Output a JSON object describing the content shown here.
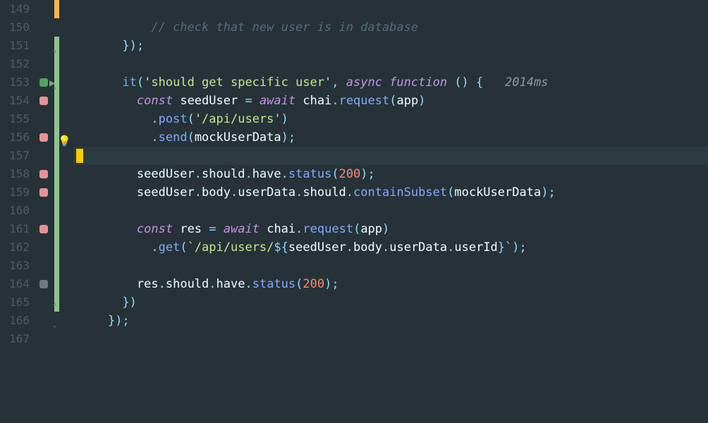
{
  "lines": [
    {
      "num": "149",
      "marker": "",
      "code": "",
      "indent": ""
    },
    {
      "num": "150",
      "marker": "",
      "code": "comment",
      "indent": "          "
    },
    {
      "num": "151",
      "marker": "",
      "code": "close1",
      "indent": "      "
    },
    {
      "num": "152",
      "marker": "",
      "code": "",
      "indent": ""
    },
    {
      "num": "153",
      "marker": "green-run",
      "code": "it",
      "indent": "      "
    },
    {
      "num": "154",
      "marker": "pink",
      "code": "const1",
      "indent": "        "
    },
    {
      "num": "155",
      "marker": "",
      "code": "post",
      "indent": "          "
    },
    {
      "num": "156",
      "marker": "pink",
      "code": "send",
      "indent": "          "
    },
    {
      "num": "157",
      "marker": "",
      "code": "",
      "indent": "",
      "highlighted": true
    },
    {
      "num": "158",
      "marker": "pink",
      "code": "status1",
      "indent": "        "
    },
    {
      "num": "159",
      "marker": "pink",
      "code": "subset",
      "indent": "        "
    },
    {
      "num": "160",
      "marker": "",
      "code": "",
      "indent": ""
    },
    {
      "num": "161",
      "marker": "pink",
      "code": "const2",
      "indent": "        "
    },
    {
      "num": "162",
      "marker": "",
      "code": "get",
      "indent": "          "
    },
    {
      "num": "163",
      "marker": "",
      "code": "",
      "indent": ""
    },
    {
      "num": "164",
      "marker": "gray",
      "code": "status2",
      "indent": "        "
    },
    {
      "num": "165",
      "marker": "",
      "code": "close2",
      "indent": "      "
    },
    {
      "num": "166",
      "marker": "",
      "code": "close3",
      "indent": "    "
    },
    {
      "num": "167",
      "marker": "",
      "code": "",
      "indent": ""
    }
  ],
  "text": {
    "comment": "// check that new user is in database",
    "close_brace_paren_semi": "});",
    "close_brace_paren": "})",
    "it_fn": "it",
    "it_string": "'should get specific user'",
    "async": "async",
    "function": "function",
    "timing": "2014ms",
    "const": "const",
    "await": "await",
    "seedUser": "seedUser",
    "chai": "chai",
    "request": "request",
    "app": "app",
    "post": "post",
    "post_path": "'/api/users'",
    "send": "send",
    "mockUserData": "mockUserData",
    "should": "should",
    "have": "have",
    "status": "status",
    "status_200": "200",
    "body": "body",
    "userData": "userData",
    "containSubset": "containSubset",
    "res": "res",
    "get": "get",
    "get_path_start": "`/api/users/",
    "userId": "userId",
    "eq": " = ",
    "comma": ", ",
    "dot": ".",
    "lparen": "(",
    "rparen": ")",
    "lbrace": "{",
    "rbrace": "}",
    "semi": ";",
    "empty_parens": " () ",
    "dollar_open": "${",
    "close_brace": "}",
    "backtick": "`"
  }
}
